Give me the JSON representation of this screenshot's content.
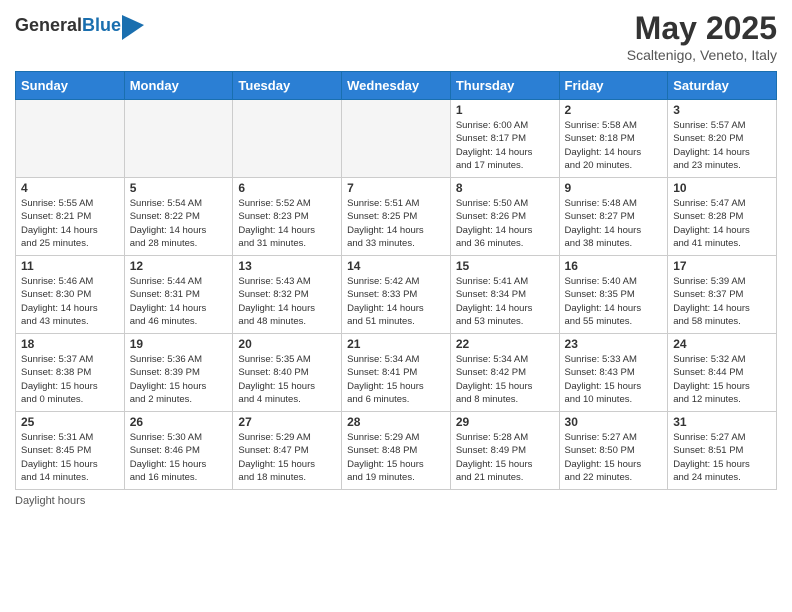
{
  "logo": {
    "general": "General",
    "blue": "Blue"
  },
  "header": {
    "month": "May 2025",
    "location": "Scaltenigo, Veneto, Italy"
  },
  "days_of_week": [
    "Sunday",
    "Monday",
    "Tuesday",
    "Wednesday",
    "Thursday",
    "Friday",
    "Saturday"
  ],
  "footer": {
    "daylight_label": "Daylight hours"
  },
  "weeks": [
    {
      "days": [
        {
          "num": "",
          "info": "",
          "empty": true
        },
        {
          "num": "",
          "info": "",
          "empty": true
        },
        {
          "num": "",
          "info": "",
          "empty": true
        },
        {
          "num": "",
          "info": "",
          "empty": true
        },
        {
          "num": "1",
          "info": "Sunrise: 6:00 AM\nSunset: 8:17 PM\nDaylight: 14 hours\nand 17 minutes."
        },
        {
          "num": "2",
          "info": "Sunrise: 5:58 AM\nSunset: 8:18 PM\nDaylight: 14 hours\nand 20 minutes."
        },
        {
          "num": "3",
          "info": "Sunrise: 5:57 AM\nSunset: 8:20 PM\nDaylight: 14 hours\nand 23 minutes."
        }
      ]
    },
    {
      "days": [
        {
          "num": "4",
          "info": "Sunrise: 5:55 AM\nSunset: 8:21 PM\nDaylight: 14 hours\nand 25 minutes."
        },
        {
          "num": "5",
          "info": "Sunrise: 5:54 AM\nSunset: 8:22 PM\nDaylight: 14 hours\nand 28 minutes."
        },
        {
          "num": "6",
          "info": "Sunrise: 5:52 AM\nSunset: 8:23 PM\nDaylight: 14 hours\nand 31 minutes."
        },
        {
          "num": "7",
          "info": "Sunrise: 5:51 AM\nSunset: 8:25 PM\nDaylight: 14 hours\nand 33 minutes."
        },
        {
          "num": "8",
          "info": "Sunrise: 5:50 AM\nSunset: 8:26 PM\nDaylight: 14 hours\nand 36 minutes."
        },
        {
          "num": "9",
          "info": "Sunrise: 5:48 AM\nSunset: 8:27 PM\nDaylight: 14 hours\nand 38 minutes."
        },
        {
          "num": "10",
          "info": "Sunrise: 5:47 AM\nSunset: 8:28 PM\nDaylight: 14 hours\nand 41 minutes."
        }
      ]
    },
    {
      "days": [
        {
          "num": "11",
          "info": "Sunrise: 5:46 AM\nSunset: 8:30 PM\nDaylight: 14 hours\nand 43 minutes."
        },
        {
          "num": "12",
          "info": "Sunrise: 5:44 AM\nSunset: 8:31 PM\nDaylight: 14 hours\nand 46 minutes."
        },
        {
          "num": "13",
          "info": "Sunrise: 5:43 AM\nSunset: 8:32 PM\nDaylight: 14 hours\nand 48 minutes."
        },
        {
          "num": "14",
          "info": "Sunrise: 5:42 AM\nSunset: 8:33 PM\nDaylight: 14 hours\nand 51 minutes."
        },
        {
          "num": "15",
          "info": "Sunrise: 5:41 AM\nSunset: 8:34 PM\nDaylight: 14 hours\nand 53 minutes."
        },
        {
          "num": "16",
          "info": "Sunrise: 5:40 AM\nSunset: 8:35 PM\nDaylight: 14 hours\nand 55 minutes."
        },
        {
          "num": "17",
          "info": "Sunrise: 5:39 AM\nSunset: 8:37 PM\nDaylight: 14 hours\nand 58 minutes."
        }
      ]
    },
    {
      "days": [
        {
          "num": "18",
          "info": "Sunrise: 5:37 AM\nSunset: 8:38 PM\nDaylight: 15 hours\nand 0 minutes."
        },
        {
          "num": "19",
          "info": "Sunrise: 5:36 AM\nSunset: 8:39 PM\nDaylight: 15 hours\nand 2 minutes."
        },
        {
          "num": "20",
          "info": "Sunrise: 5:35 AM\nSunset: 8:40 PM\nDaylight: 15 hours\nand 4 minutes."
        },
        {
          "num": "21",
          "info": "Sunrise: 5:34 AM\nSunset: 8:41 PM\nDaylight: 15 hours\nand 6 minutes."
        },
        {
          "num": "22",
          "info": "Sunrise: 5:34 AM\nSunset: 8:42 PM\nDaylight: 15 hours\nand 8 minutes."
        },
        {
          "num": "23",
          "info": "Sunrise: 5:33 AM\nSunset: 8:43 PM\nDaylight: 15 hours\nand 10 minutes."
        },
        {
          "num": "24",
          "info": "Sunrise: 5:32 AM\nSunset: 8:44 PM\nDaylight: 15 hours\nand 12 minutes."
        }
      ]
    },
    {
      "days": [
        {
          "num": "25",
          "info": "Sunrise: 5:31 AM\nSunset: 8:45 PM\nDaylight: 15 hours\nand 14 minutes."
        },
        {
          "num": "26",
          "info": "Sunrise: 5:30 AM\nSunset: 8:46 PM\nDaylight: 15 hours\nand 16 minutes."
        },
        {
          "num": "27",
          "info": "Sunrise: 5:29 AM\nSunset: 8:47 PM\nDaylight: 15 hours\nand 18 minutes."
        },
        {
          "num": "28",
          "info": "Sunrise: 5:29 AM\nSunset: 8:48 PM\nDaylight: 15 hours\nand 19 minutes."
        },
        {
          "num": "29",
          "info": "Sunrise: 5:28 AM\nSunset: 8:49 PM\nDaylight: 15 hours\nand 21 minutes."
        },
        {
          "num": "30",
          "info": "Sunrise: 5:27 AM\nSunset: 8:50 PM\nDaylight: 15 hours\nand 22 minutes."
        },
        {
          "num": "31",
          "info": "Sunrise: 5:27 AM\nSunset: 8:51 PM\nDaylight: 15 hours\nand 24 minutes."
        }
      ]
    }
  ]
}
